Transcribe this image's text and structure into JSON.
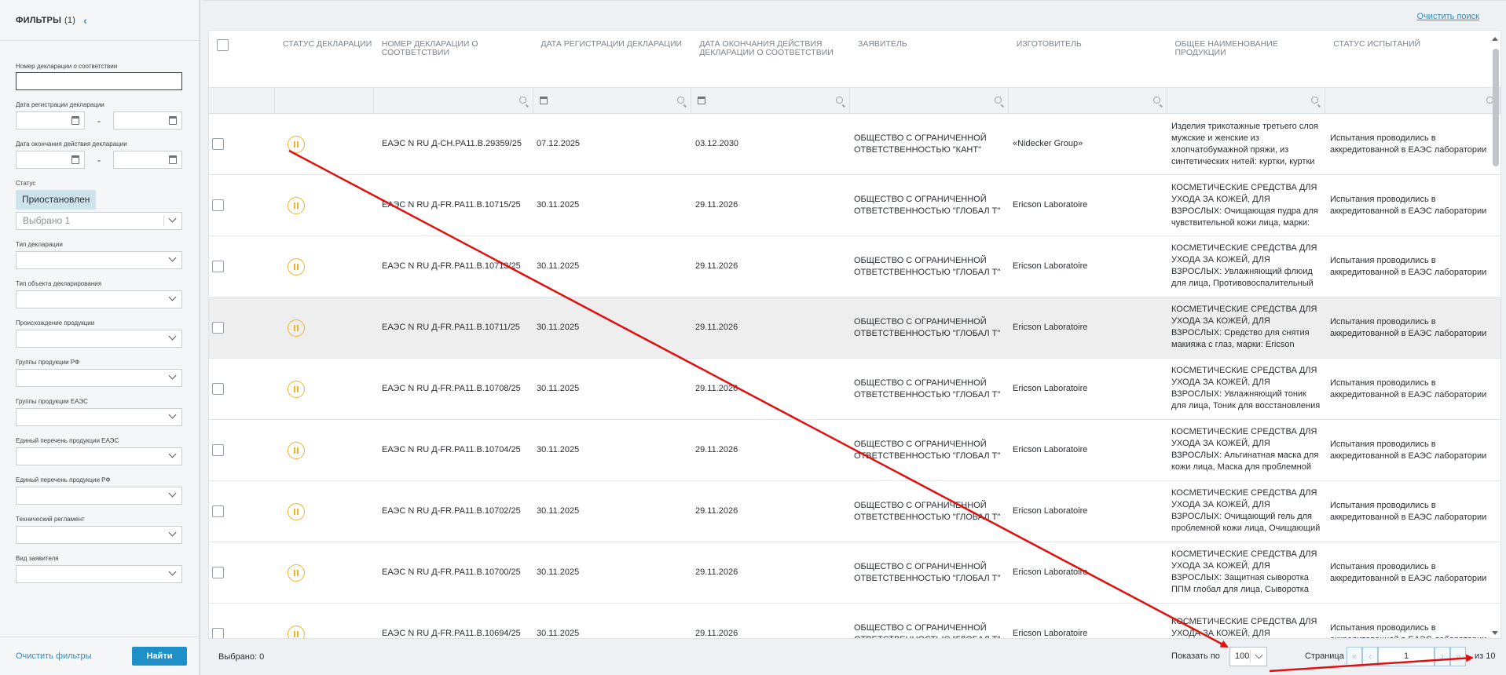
{
  "sidebar": {
    "title": "ФИЛЬТРЫ",
    "count": "(1)",
    "collapse_icon": "chevron-left-icon",
    "fields": {
      "decl_number": "Номер декларации о соответствии",
      "reg_date": "Дата регистрации декларации",
      "end_date": "Дата окончания действия декларации",
      "status": "Статус",
      "status_chip": "Приостановлен",
      "status_select": "Выбрано 1",
      "decl_type": "Тип декларации",
      "object_type": "Тип объекта декларирования",
      "origin": "Происхождение продукции",
      "groups_rf": "Группы продукции РФ",
      "groups_eaes": "Группы продукции ЕАЭС",
      "list_eaes": "Единый перечень продукции ЕАЭС",
      "list_rf": "Единый перечень продукции РФ",
      "tech_reg": "Технический регламент",
      "applicant_kind": "Вид заявителя"
    },
    "dash": "-",
    "clear_filters": "Очистить фильтры",
    "find": "Найти"
  },
  "top": {
    "clear_search": "Очистить поиск"
  },
  "table": {
    "headers": [
      "СТАТУС ДЕКЛАРАЦИИ",
      "НОМЕР ДЕКЛАРАЦИИ О СООТВЕТСТВИИ",
      "ДАТА РЕГИСТРАЦИИ ДЕКЛАРАЦИИ",
      "ДАТА ОКОНЧАНИЯ ДЕЙСТВИЯ ДЕКЛАРАЦИИ О СООТВЕТСТВИИ",
      "ЗАЯВИТЕЛЬ",
      "ИЗГОТОВИТЕЛЬ",
      "ОБЩЕЕ НАИМЕНОВАНИЕ ПРОДУКЦИИ",
      "СТАТУС ИСПЫТАНИЙ"
    ],
    "status_icon": "pause-circle-icon",
    "rows": [
      {
        "number": "ЕАЭС N RU Д-CH.PA11.B.29359/25",
        "reg": "07.12.2025",
        "end": "03.12.2030",
        "applicant": "ОБЩЕСТВО С ОГРАНИЧЕННОЙ ОТВЕТСТВЕННОСТЬЮ \"КАНТ\"",
        "maker": "«Nidecker Group»",
        "product": "Изделия трикотажные третьего слоя мужские и женские из хлопчатобумажной пряжи, из синтетических нитей: куртки, куртки",
        "tests": "Испытания проводились в аккредитованной в ЕАЭС лаборатории"
      },
      {
        "number": "ЕАЭС N RU Д-FR.PA11.B.10715/25",
        "reg": "30.11.2025",
        "end": "29.11.2026",
        "applicant": "ОБЩЕСТВО С ОГРАНИЧЕННОЙ ОТВЕТСТВЕННОСТЬЮ \"ГЛОБАЛ Т\"",
        "maker": "Ericson Laboratoire",
        "product": "КОСМЕТИЧЕСКИЕ СРЕДСТВА ДЛЯ УХОДА ЗА КОЖЕЙ, ДЛЯ ВЗРОСЛЫХ: Очищающая пудра для чувствительной кожи лица, марки:",
        "tests": "Испытания проводились в аккредитованной в ЕАЭС лаборатории"
      },
      {
        "number": "ЕАЭС N RU Д-FR.PA11.B.10713/25",
        "reg": "30.11.2025",
        "end": "29.11.2026",
        "applicant": "ОБЩЕСТВО С ОГРАНИЧЕННОЙ ОТВЕТСТВЕННОСТЬЮ \"ГЛОБАЛ Т\"",
        "maker": "Ericson Laboratoire",
        "product": "КОСМЕТИЧЕСКИЕ СРЕДСТВА ДЛЯ УХОДА ЗА КОЖЕЙ, ДЛЯ ВЗРОСЛЫХ: Увлажняющий флюид для лица, Противовоспалительный флюид,",
        "tests": "Испытания проводились в аккредитованной в ЕАЭС лаборатории"
      },
      {
        "number": "ЕАЭС N RU Д-FR.PA11.B.10711/25",
        "reg": "30.11.2025",
        "end": "29.11.2026",
        "applicant": "ОБЩЕСТВО С ОГРАНИЧЕННОЙ ОТВЕТСТВЕННОСТЬЮ \"ГЛОБАЛ Т\"",
        "maker": "Ericson Laboratoire",
        "product": "КОСМЕТИЧЕСКИЕ СРЕДСТВА ДЛЯ УХОДА ЗА КОЖЕЙ, ДЛЯ ВЗРОСЛЫХ: Средство для снятия макияжа с глаз, марки: Ericson Laboratoire",
        "tests": "Испытания проводились в аккредитованной в ЕАЭС лаборатории"
      },
      {
        "number": "ЕАЭС N RU Д-FR.PA11.B.10708/25",
        "reg": "30.11.2025",
        "end": "29.11.2026",
        "applicant": "ОБЩЕСТВО С ОГРАНИЧЕННОЙ ОТВЕТСТВЕННОСТЬЮ \"ГЛОБАЛ Т\"",
        "maker": "Ericson Laboratoire",
        "product": "КОСМЕТИЧЕСКИЕ СРЕДСТВА ДЛЯ УХОДА ЗА КОЖЕЙ, ДЛЯ ВЗРОСЛЫХ: Увлажняющий тоник для лица, Тоник для восстановления микробиома",
        "tests": "Испытания проводились в аккредитованной в ЕАЭС лаборатории"
      },
      {
        "number": "ЕАЭС N RU Д-FR.PA11.B.10704/25",
        "reg": "30.11.2025",
        "end": "29.11.2026",
        "applicant": "ОБЩЕСТВО С ОГРАНИЧЕННОЙ ОТВЕТСТВЕННОСТЬЮ \"ГЛОБАЛ Т\"",
        "maker": "Ericson Laboratoire",
        "product": "КОСМЕТИЧЕСКИЕ СРЕДСТВА ДЛЯ УХОДА ЗА КОЖЕЙ, ДЛЯ ВЗРОСЛЫХ: Альгинатная маска для кожи лица, Маска для проблемной кожи лица,",
        "tests": "Испытания проводились в аккредитованной в ЕАЭС лаборатории"
      },
      {
        "number": "ЕАЭС N RU Д-FR.PA11.B.10702/25",
        "reg": "30.11.2025",
        "end": "29.11.2026",
        "applicant": "ОБЩЕСТВО С ОГРАНИЧЕННОЙ ОТВЕТСТВЕННОСТЬЮ \"ГЛОБАЛ Т\"",
        "maker": "Ericson Laboratoire",
        "product": "КОСМЕТИЧЕСКИЕ СРЕДСТВА ДЛЯ УХОДА ЗА КОЖЕЙ, ДЛЯ ВЗРОСЛЫХ: Очищающий гель для проблемной кожи лица, Очищающий гель для",
        "tests": "Испытания проводились в аккредитованной в ЕАЭС лаборатории"
      },
      {
        "number": "ЕАЭС N RU Д-FR.PA11.B.10700/25",
        "reg": "30.11.2025",
        "end": "29.11.2026",
        "applicant": "ОБЩЕСТВО С ОГРАНИЧЕННОЙ ОТВЕТСТВЕННОСТЬЮ \"ГЛОБАЛ Т\"",
        "maker": "Ericson Laboratoire",
        "product": "КОСМЕТИЧЕСКИЕ СРЕДСТВА ДЛЯ УХОДА ЗА КОЖЕЙ, ДЛЯ ВЗРОСЛЫХ: Защитная сыворотка ППМ глобал для лица, Сыворотка увлажняющая для",
        "tests": "Испытания проводились в аккредитованной в ЕАЭС лаборатории"
      },
      {
        "number": "ЕАЭС N RU Д-FR.PA11.B.10694/25",
        "reg": "30.11.2025",
        "end": "29.11.2026",
        "applicant": "ОБЩЕСТВО С ОГРАНИЧЕННОЙ ОТВЕТСТВЕННОСТЬЮ \"ГЛОБАЛ Т\"",
        "maker": "Ericson Laboratoire",
        "product": "КОСМЕТИЧЕСКИЕ СРЕДСТВА ДЛЯ УХОДА ЗА КОЖЕЙ, ДЛЯ ВЗРОСЛЫХ:",
        "tests": "Испытания проводились в аккредитованной в ЕАЭС лаборатории"
      }
    ],
    "highlighted_row": 3
  },
  "footer": {
    "selected": "Выбрано: 0",
    "show_per": "Показать по",
    "per_value": "100",
    "page_label": "Страница",
    "page_value": "1",
    "of_pages": "из 10",
    "first_icon": "double-chevron-left-icon",
    "prev_icon": "chevron-left-icon",
    "next_icon": "chevron-right-icon",
    "last_icon": "double-chevron-right-icon"
  },
  "colors": {
    "accent": "#1f8fc9",
    "status": "#f0b429",
    "arrow": "#e01010"
  }
}
